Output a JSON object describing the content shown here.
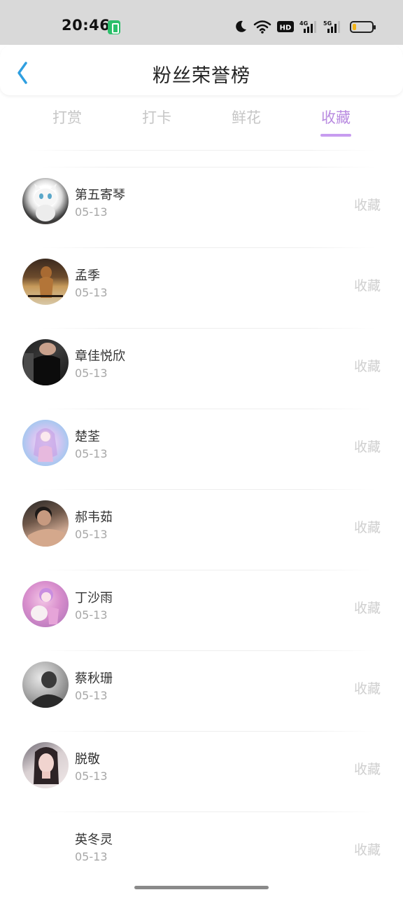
{
  "status_bar": {
    "time": "20:46",
    "icons": [
      "battery-saver-icon",
      "moon-icon",
      "wifi-icon",
      "hd-icon",
      "signal-4g-icon",
      "signal-5g-icon",
      "battery-icon"
    ],
    "hd_label": "HD",
    "sim1_label": "4G",
    "sim2_label": "5G",
    "battery_level": 0.2
  },
  "header": {
    "title": "粉丝荣誉榜",
    "back_icon": "chevron-left-icon",
    "accent_color": "#2f9fe0"
  },
  "tabs": [
    {
      "label": "打赏",
      "active": false
    },
    {
      "label": "打卡",
      "active": false
    },
    {
      "label": "鲜花",
      "active": false
    },
    {
      "label": "收藏",
      "active": true
    }
  ],
  "tab_active_color": "#b98be0",
  "list": {
    "items": [
      {
        "name": "第五寄琴",
        "date": "05-13",
        "action": "收藏",
        "avatar": "cartoon-cat"
      },
      {
        "name": "孟季",
        "date": "05-13",
        "action": "收藏",
        "avatar": "brown-figure"
      },
      {
        "name": "章佳悦欣",
        "date": "05-13",
        "action": "收藏",
        "avatar": "dark-portrait"
      },
      {
        "name": "楚荃",
        "date": "05-13",
        "action": "收藏",
        "avatar": "pastel-anime"
      },
      {
        "name": "郝韦茹",
        "date": "05-13",
        "action": "收藏",
        "avatar": "man-portrait"
      },
      {
        "name": "丁沙雨",
        "date": "05-13",
        "action": "收藏",
        "avatar": "pink-doll"
      },
      {
        "name": "蔡秋珊",
        "date": "05-13",
        "action": "收藏",
        "avatar": "grayscale-person"
      },
      {
        "name": "脱敬",
        "date": "05-13",
        "action": "收藏",
        "avatar": "woman-portrait"
      },
      {
        "name": "英冬灵",
        "date": "05-13",
        "action": "收藏",
        "avatar": "none"
      }
    ]
  }
}
